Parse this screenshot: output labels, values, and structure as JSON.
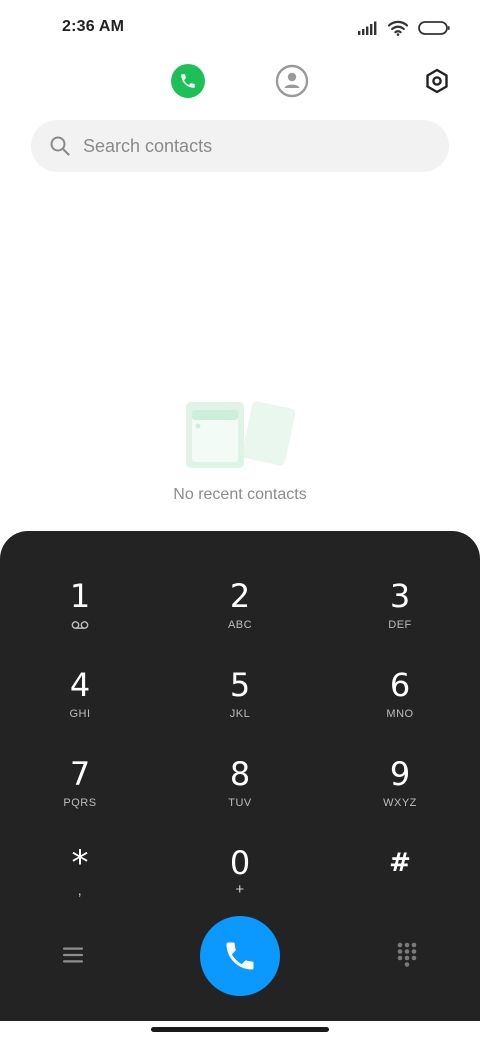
{
  "status_bar": {
    "time": "2:36 AM",
    "icons": [
      "signal-icon",
      "wifi-icon",
      "battery-icon"
    ]
  },
  "header": {
    "tabs": [
      {
        "name": "recents",
        "icon": "phone-icon",
        "active": true,
        "accent": "#1fbf57"
      },
      {
        "name": "contacts",
        "icon": "person-icon",
        "active": false
      }
    ],
    "settings_icon": "settings-icon"
  },
  "search": {
    "placeholder": "Search contacts"
  },
  "empty_state": {
    "icon": "contacts-cards-icon",
    "text": "No recent contacts"
  },
  "dialpad": {
    "background": "#232323",
    "keys": [
      {
        "digit": "1",
        "sub": "",
        "sub_icon": "voicemail-icon"
      },
      {
        "digit": "2",
        "sub": "ABC"
      },
      {
        "digit": "3",
        "sub": "DEF"
      },
      {
        "digit": "4",
        "sub": "GHI"
      },
      {
        "digit": "5",
        "sub": "JKL"
      },
      {
        "digit": "6",
        "sub": "MNO"
      },
      {
        "digit": "7",
        "sub": "PQRS"
      },
      {
        "digit": "8",
        "sub": "TUV"
      },
      {
        "digit": "9",
        "sub": "WXYZ"
      },
      {
        "digit": "*",
        "sub": ","
      },
      {
        "digit": "0",
        "sub": "+"
      },
      {
        "digit": "#",
        "sub": ""
      }
    ],
    "bottom": {
      "menu_icon": "menu-icon",
      "call_icon": "phone-icon",
      "call_color": "#0b99ff",
      "keypad_icon": "dialpad-grid-icon"
    }
  }
}
